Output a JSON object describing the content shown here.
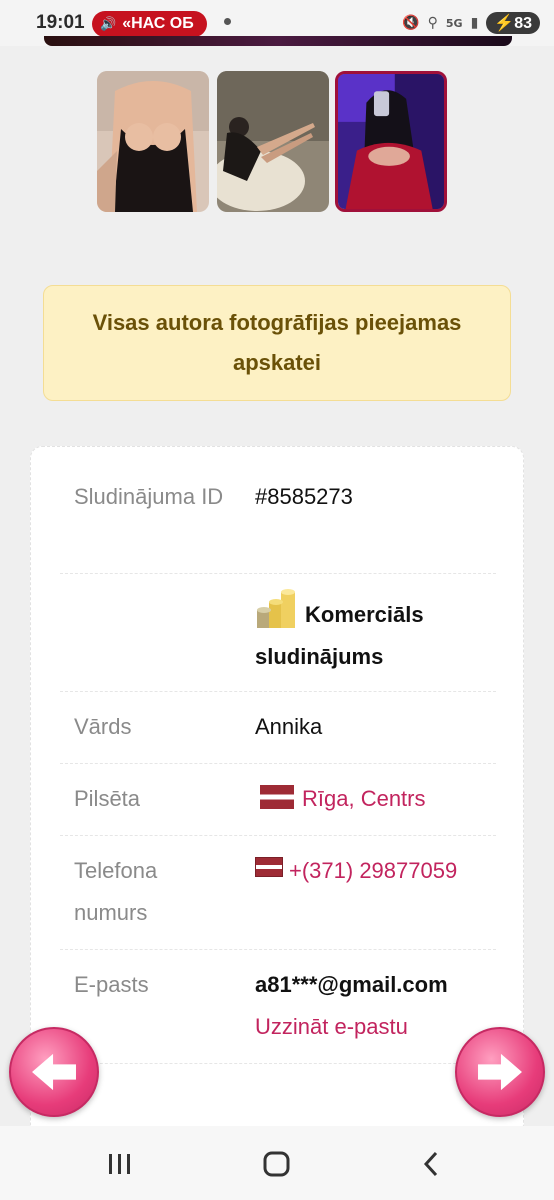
{
  "status_bar": {
    "time": "19:01",
    "pill_text": "«НАС ОБ",
    "battery": "83",
    "network": "5G",
    "pill_color": "#c6121f"
  },
  "gallery": {
    "thumbnails": [
      "photo-1",
      "photo-2",
      "photo-3"
    ],
    "selected_index": 2,
    "selected_border_color": "#a0103a"
  },
  "notice": {
    "text": "Visas autora fotogrāfijas pieejamas apskatei",
    "background": "#fdf1c4"
  },
  "details": {
    "ad_id_label": "Sludinājuma ID",
    "ad_id_value": "#8585273",
    "commercial_label": "Komerciāls sludinājums",
    "name_label": "Vārds",
    "name_value": "Annika",
    "city_label": "Pilsēta",
    "city_value": "Rīga, Centrs",
    "phone_label": "Telefona numurs",
    "phone_value": "+(371) 29877059",
    "email_label": "E-pasts",
    "email_value": "a81***@gmail.com",
    "email_link": "Uzzināt e-pastu",
    "link_color": "#c2245e"
  },
  "navigation": {
    "prev": "previous-arrow",
    "next": "next-arrow",
    "arrow_color": "#e73c7a"
  },
  "system_nav": [
    "recents",
    "home",
    "back"
  ]
}
